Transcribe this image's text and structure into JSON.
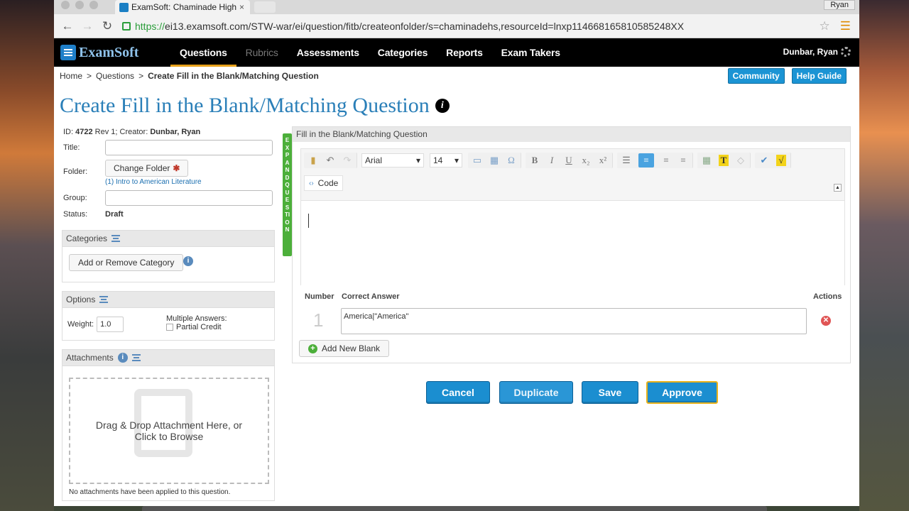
{
  "browser": {
    "tab_title": "ExamSoft: Chaminade High",
    "tab_close": "×",
    "user": "Ryan",
    "url_scheme": "https://",
    "url_rest": "ei13.examsoft.com/STW-war/ei/question/fitb/createonfolder/s=chaminadehs,resourceId=lnxp114668165810585248XX",
    "back": "←",
    "forward": "→",
    "reload": "↻",
    "star": "☆",
    "menu": "☰"
  },
  "nav": {
    "logo": "ExamSoft",
    "items": [
      {
        "label": "Questions",
        "state": "active"
      },
      {
        "label": "Rubrics",
        "state": "dim"
      },
      {
        "label": "Assessments",
        "state": ""
      },
      {
        "label": "Categories",
        "state": ""
      },
      {
        "label": "Reports",
        "state": ""
      },
      {
        "label": "Exam Takers",
        "state": ""
      }
    ],
    "user": "Dunbar, Ryan"
  },
  "breadcrumb": {
    "home": "Home",
    "questions": "Questions",
    "current": "Create Fill in the Blank/Matching Question",
    "sep": ">"
  },
  "help": {
    "community": "Community",
    "guide": "Help Guide"
  },
  "page": {
    "title": "Create Fill in the Blank/Matching Question",
    "info": "i"
  },
  "meta": {
    "id_label": "ID:",
    "id": "4722",
    "rev": "Rev 1",
    "creator_label": "; Creator:",
    "creator": "Dunbar, Ryan"
  },
  "form": {
    "title_label": "Title:",
    "title_value": "",
    "folder_label": "Folder:",
    "change_folder": "Change Folder",
    "required_mark": "✱",
    "folder_link": "(1) Intro to American Literature",
    "group_label": "Group:",
    "group_value": "",
    "status_label": "Status:",
    "status_value": "Draft"
  },
  "categories": {
    "title": "Categories",
    "button": "Add or Remove Category",
    "info": "i"
  },
  "options": {
    "title": "Options",
    "weight_label": "Weight:",
    "weight_value": "1.0",
    "multi_label": "Multiple Answers:",
    "partial_label": "Partial Credit"
  },
  "attachments": {
    "title": "Attachments",
    "info": "i",
    "drop_text": "Drag & Drop Attachment Here, or Click to Browse",
    "empty_text": "No attachments have been applied to this question."
  },
  "expand_label": "EXPAND QUESTION",
  "editor": {
    "panel_title": "Fill in the Blank/Matching Question",
    "font": "Arial",
    "size": "14",
    "code_label": "Code",
    "collapse": "▲",
    "undo": "↶",
    "redo": "↷",
    "omega": "Ω",
    "bold": "B",
    "italic": "I",
    "underline": "U",
    "sub": "x₂",
    "sup": "x²",
    "list": "☰",
    "align_left": "≡",
    "align_center": "≡",
    "align_right": "≡",
    "text_color": "T",
    "spell": "✔",
    "sqrt": "√"
  },
  "answers": {
    "col_number": "Number",
    "col_answer": "Correct Answer",
    "col_actions": "Actions",
    "rows": [
      {
        "number": "1",
        "answer": "America|\"America\""
      }
    ],
    "delete": "✕",
    "add_plus": "+",
    "add_label": "Add New Blank"
  },
  "actions": {
    "cancel": "Cancel",
    "duplicate": "Duplicate",
    "save": "Save",
    "approve": "Approve"
  }
}
